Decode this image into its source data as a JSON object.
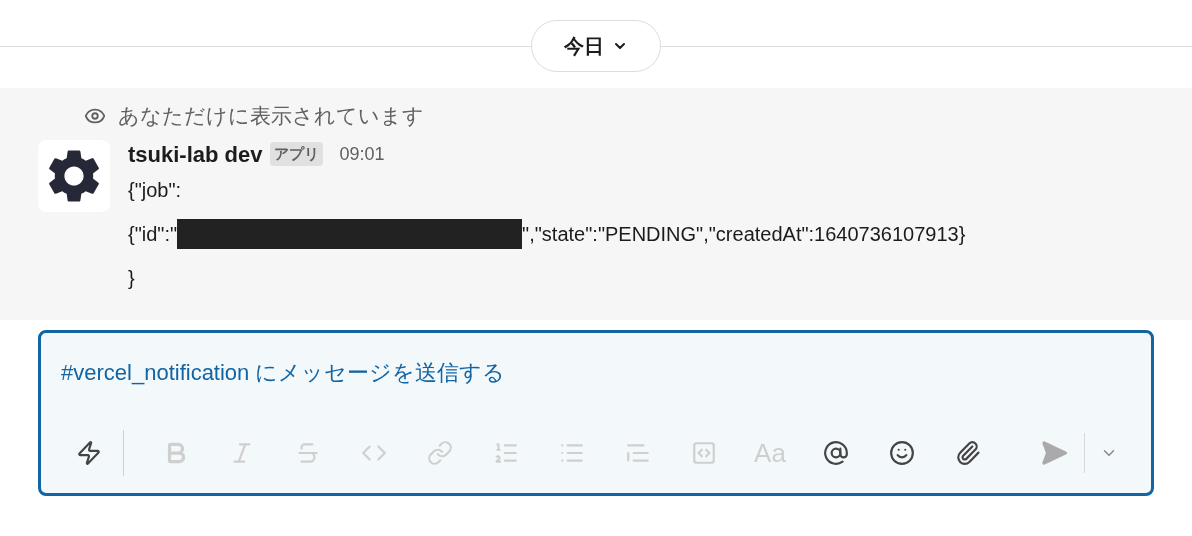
{
  "date_divider": {
    "label": "今日"
  },
  "message": {
    "visibility_note": "あなただけに表示されています",
    "sender": "tsuki-lab dev",
    "badge": "アプリ",
    "time": "09:01",
    "lines": [
      {
        "kind": "text",
        "text": "{\"job\":"
      },
      {
        "kind": "redacted",
        "before": "{\"id\":\"",
        "after": "\",\"state\":\"PENDING\",\"createdAt\":1640736107913}"
      },
      {
        "kind": "text",
        "text": "}"
      }
    ]
  },
  "composer": {
    "placeholder": "#vercel_notification にメッセージを送信する",
    "tools": [
      {
        "kind": "shortcuts",
        "disabled": false
      },
      {
        "kind": "bold",
        "disabled": true
      },
      {
        "kind": "italic",
        "disabled": true
      },
      {
        "kind": "strike",
        "disabled": true
      },
      {
        "kind": "code",
        "disabled": true
      },
      {
        "kind": "link",
        "disabled": true
      },
      {
        "kind": "ordered-list",
        "disabled": true
      },
      {
        "kind": "bullet-list",
        "disabled": true
      },
      {
        "kind": "quote",
        "disabled": true
      },
      {
        "kind": "code-block",
        "disabled": true
      },
      {
        "kind": "format",
        "label": "Aa",
        "disabled": true
      },
      {
        "kind": "mention",
        "disabled": false
      },
      {
        "kind": "emoji",
        "disabled": false
      },
      {
        "kind": "attach",
        "disabled": false
      }
    ],
    "send": {
      "disabled": true
    }
  }
}
